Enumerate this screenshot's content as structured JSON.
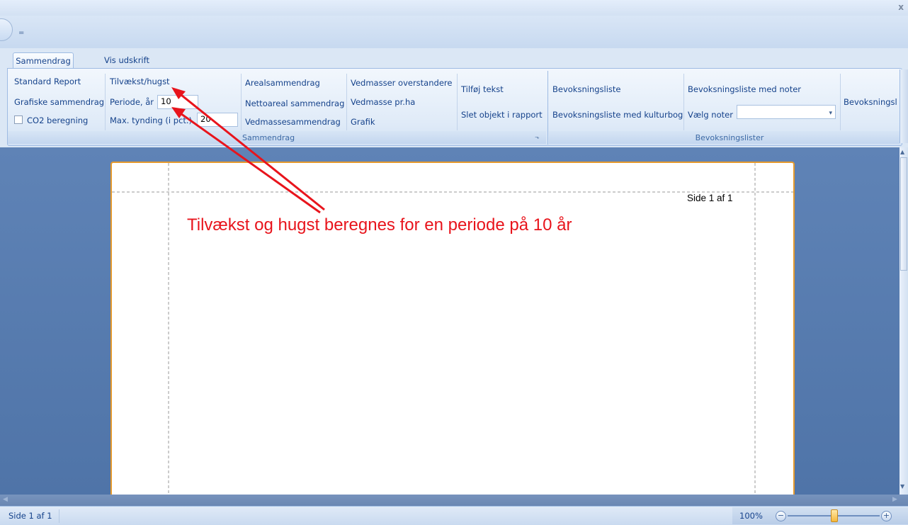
{
  "window": {
    "close_glyph": "x",
    "qat_glyph": "="
  },
  "tabs": [
    {
      "label": "Sammendrag",
      "active": true
    },
    {
      "label": "Vis udskrift",
      "active": false
    }
  ],
  "ribbon": {
    "col1": {
      "standard": "Standard Report",
      "grafiske": "Grafiske sammendrag",
      "co2": "CO2 beregning"
    },
    "col2": {
      "tilvaekst": "Tilvækst/hugst",
      "periode_label": "Periode, år",
      "periode_value": "10",
      "tynding_label": "Max. tynding (i pct.)",
      "tynding_value": "20"
    },
    "col3": {
      "areal": "Arealsammendrag",
      "netto": "Nettoareal sammendrag",
      "vedmasse": "Vedmassesammendrag"
    },
    "col4": {
      "overstandere": "Vedmasser overstandere",
      "prha": "Vedmasse pr.ha",
      "grafik": "Grafik"
    },
    "col5": {
      "tilfoej": "Tilføj tekst",
      "slet": "Slet objekt i rapport"
    },
    "group1_label": "Sammendrag",
    "group2": {
      "liste": "Bevoksningsliste",
      "kulturbog": "Bevoksningsliste med kulturbog",
      "med_noter": "Bevoksningsliste med noter",
      "vaelg_noter": "Vælg noter",
      "dropdown_value": "",
      "truncated": "Bevoksningsli",
      "label": "Bevoksningslister"
    }
  },
  "page": {
    "side_label": "Side 1 af 1"
  },
  "annotation": {
    "text": "Tilvækst og hugst beregnes for en periode på 10 år",
    "color": "#e8141c"
  },
  "statusbar": {
    "page": "Side 1 af 1",
    "zoom": "100%",
    "zoom_percent": 100
  },
  "colors": {
    "workspace": "#4f74a8",
    "page_border": "#e59a2e",
    "ribbon_text": "#15428b"
  }
}
